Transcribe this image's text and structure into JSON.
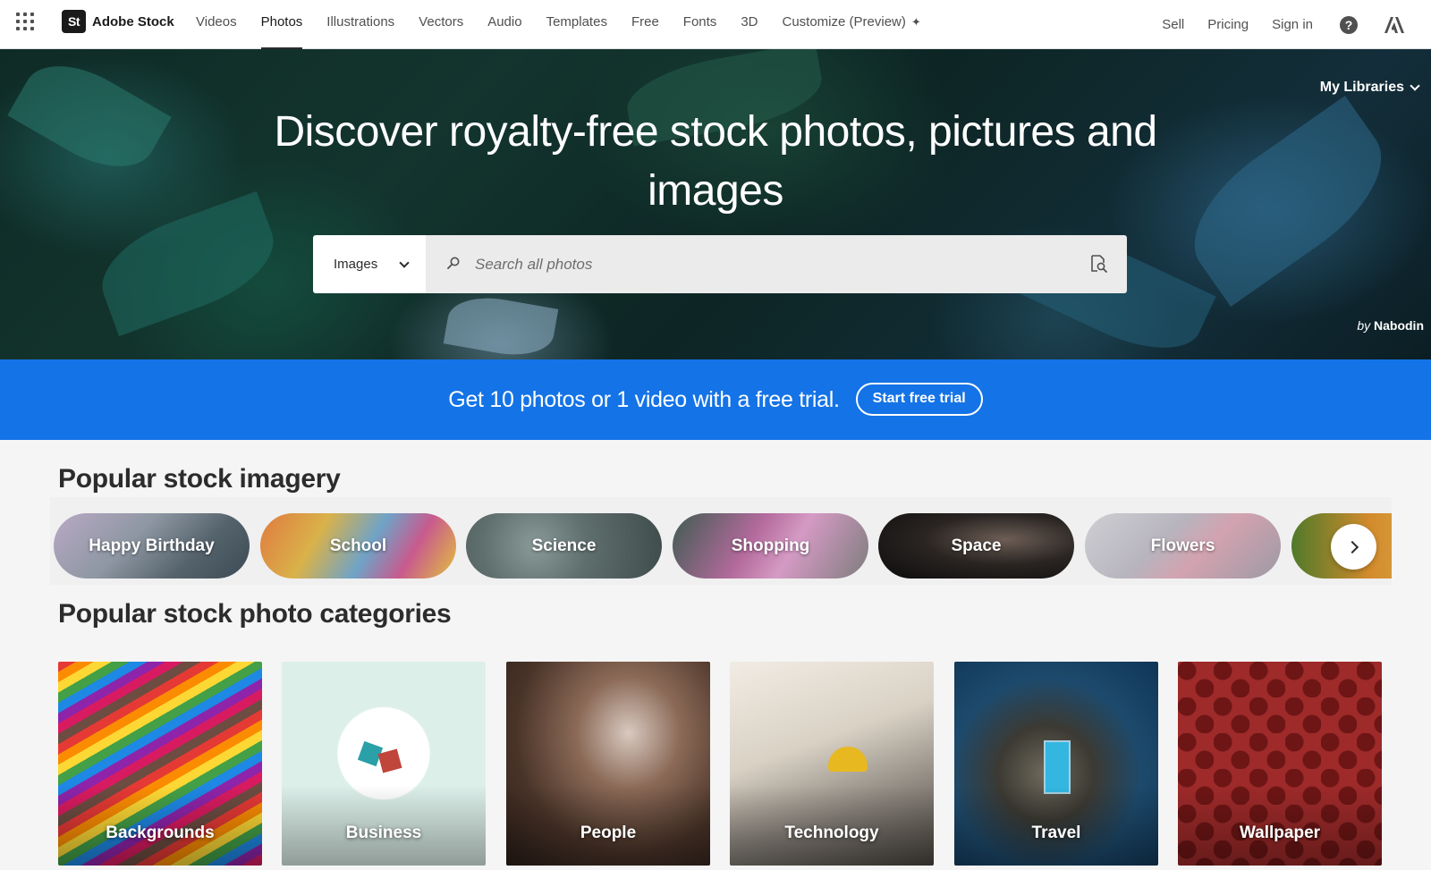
{
  "brand": {
    "mark": "St",
    "name": "Adobe Stock"
  },
  "nav": {
    "links": [
      "Videos",
      "Photos",
      "Illustrations",
      "Vectors",
      "Audio",
      "Templates",
      "Free",
      "Fonts",
      "3D",
      "Customize (Preview)"
    ],
    "active": "Photos",
    "right": {
      "sell": "Sell",
      "pricing": "Pricing",
      "sign_in": "Sign in"
    }
  },
  "hero": {
    "title": "Discover royalty-free stock photos, pictures and images",
    "my_libraries": "My Libraries",
    "search": {
      "type": "Images",
      "placeholder": "Search all photos"
    },
    "credit": {
      "by": "by",
      "author": "Nabodin"
    }
  },
  "promo": {
    "text": "Get 10 photos or 1 video with a free trial.",
    "cta": "Start free trial",
    "color": "#1473e6"
  },
  "popular_imagery": {
    "title": "Popular stock imagery",
    "items": [
      "Happy Birthday",
      "School",
      "Science",
      "Shopping",
      "Space",
      "Flowers"
    ]
  },
  "categories": {
    "title": "Popular stock photo categories",
    "items": [
      "Backgrounds",
      "Business",
      "People",
      "Technology",
      "Travel",
      "Wallpaper"
    ]
  }
}
